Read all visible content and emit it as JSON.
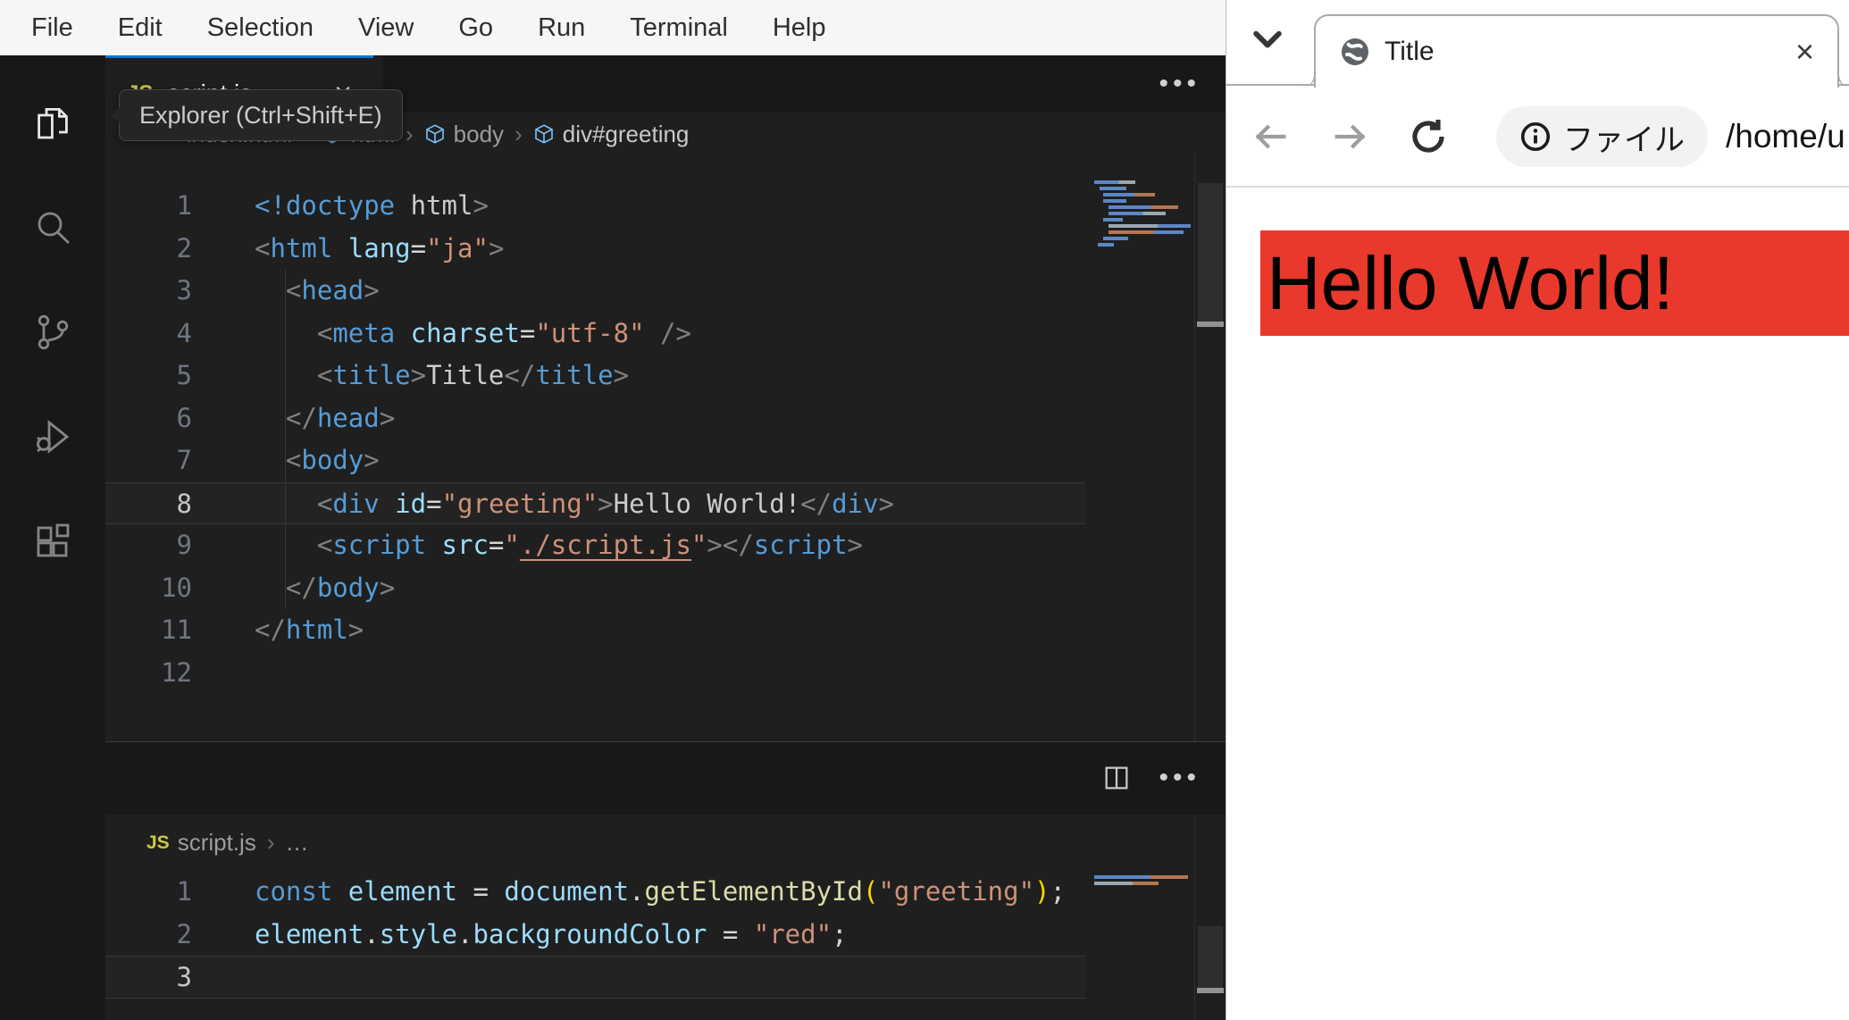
{
  "colors": {
    "accent_blue": "#0078d4",
    "banner_red": "#e9392d",
    "js_yellow": "#cbcb41",
    "html_orange": "#e37933"
  },
  "vscode": {
    "menu": [
      "File",
      "Edit",
      "Selection",
      "View",
      "Go",
      "Run",
      "Terminal",
      "Help"
    ],
    "activity_bar": [
      {
        "icon": "files-icon",
        "active": true
      },
      {
        "icon": "search-icon",
        "active": false
      },
      {
        "icon": "source-control-icon",
        "active": false
      },
      {
        "icon": "run-debug-icon",
        "active": false
      },
      {
        "icon": "extensions-icon",
        "active": false
      }
    ],
    "tooltip": "Explorer (Ctrl+Shift+E)",
    "more_actions": "•••",
    "html_editor": {
      "breadcrumbs": [
        {
          "icon": "code",
          "label": "index.html"
        },
        {
          "icon": "cube",
          "label": "html"
        },
        {
          "icon": "cube",
          "label": "body"
        },
        {
          "icon": "cube",
          "label": "div#greeting"
        }
      ],
      "active_line": 8,
      "guide_lines": [
        3,
        4,
        5,
        6,
        7,
        8,
        9,
        10
      ],
      "lines": [
        [
          {
            "c": "tag",
            "t": "<!doctype"
          },
          {
            "c": "txt",
            "t": " html"
          },
          {
            "c": "pt",
            "t": ">"
          }
        ],
        [
          {
            "c": "pt",
            "t": "<"
          },
          {
            "c": "tag",
            "t": "html"
          },
          {
            "c": "attr",
            "t": " lang"
          },
          {
            "c": "op",
            "t": "="
          },
          {
            "c": "str",
            "t": "\"ja\""
          },
          {
            "c": "pt",
            "t": ">"
          }
        ],
        [
          {
            "c": "txt",
            "t": "  "
          },
          {
            "c": "pt",
            "t": "<"
          },
          {
            "c": "tag",
            "t": "head"
          },
          {
            "c": "pt",
            "t": ">"
          }
        ],
        [
          {
            "c": "txt",
            "t": "    "
          },
          {
            "c": "pt",
            "t": "<"
          },
          {
            "c": "tag",
            "t": "meta"
          },
          {
            "c": "attr",
            "t": " charset"
          },
          {
            "c": "op",
            "t": "="
          },
          {
            "c": "str",
            "t": "\"utf-8\""
          },
          {
            "c": "pt",
            "t": " />"
          }
        ],
        [
          {
            "c": "txt",
            "t": "    "
          },
          {
            "c": "pt",
            "t": "<"
          },
          {
            "c": "tag",
            "t": "title"
          },
          {
            "c": "pt",
            "t": ">"
          },
          {
            "c": "txt",
            "t": "Title"
          },
          {
            "c": "pt",
            "t": "</"
          },
          {
            "c": "tag",
            "t": "title"
          },
          {
            "c": "pt",
            "t": ">"
          }
        ],
        [
          {
            "c": "txt",
            "t": "  "
          },
          {
            "c": "pt",
            "t": "</"
          },
          {
            "c": "tag",
            "t": "head"
          },
          {
            "c": "pt",
            "t": ">"
          }
        ],
        [
          {
            "c": "txt",
            "t": "  "
          },
          {
            "c": "pt",
            "t": "<"
          },
          {
            "c": "tag",
            "t": "body"
          },
          {
            "c": "pt",
            "t": ">"
          }
        ],
        [
          {
            "c": "txt",
            "t": "    "
          },
          {
            "c": "pt",
            "t": "<"
          },
          {
            "c": "tag",
            "t": "div"
          },
          {
            "c": "attr",
            "t": " id"
          },
          {
            "c": "op",
            "t": "="
          },
          {
            "c": "str",
            "t": "\"greeting\""
          },
          {
            "c": "pt",
            "t": ">"
          },
          {
            "c": "txt",
            "t": "Hello World!"
          },
          {
            "c": "pt",
            "t": "</"
          },
          {
            "c": "tag",
            "t": "div"
          },
          {
            "c": "pt",
            "t": ">"
          }
        ],
        [
          {
            "c": "txt",
            "t": "    "
          },
          {
            "c": "pt",
            "t": "<"
          },
          {
            "c": "tag",
            "t": "script"
          },
          {
            "c": "attr",
            "t": " src"
          },
          {
            "c": "op",
            "t": "="
          },
          {
            "c": "str",
            "t": "\""
          },
          {
            "c": "lnk",
            "t": "./script.js"
          },
          {
            "c": "str",
            "t": "\""
          },
          {
            "c": "pt",
            "t": ">"
          },
          {
            "c": "pt",
            "t": "</"
          },
          {
            "c": "tag",
            "t": "script"
          },
          {
            "c": "pt",
            "t": ">"
          }
        ],
        [
          {
            "c": "txt",
            "t": "  "
          },
          {
            "c": "pt",
            "t": "</"
          },
          {
            "c": "tag",
            "t": "body"
          },
          {
            "c": "pt",
            "t": ">"
          }
        ],
        [
          {
            "c": "pt",
            "t": "</"
          },
          {
            "c": "tag",
            "t": "html"
          },
          {
            "c": "pt",
            "t": ">"
          }
        ],
        []
      ]
    },
    "js_editor": {
      "tab": {
        "icon_label": "JS",
        "label": "script.js",
        "close": "×"
      },
      "breadcrumbs": [
        {
          "icon": "js",
          "label": "script.js"
        },
        {
          "icon": null,
          "label": "…"
        }
      ],
      "active_line": 3,
      "guide_lines": [],
      "lines": [
        [
          {
            "c": "kw",
            "t": "const"
          },
          {
            "c": "var",
            "t": " element "
          },
          {
            "c": "op",
            "t": "= "
          },
          {
            "c": "var",
            "t": "document"
          },
          {
            "c": "op",
            "t": "."
          },
          {
            "c": "fn",
            "t": "getElementById"
          },
          {
            "c": "au",
            "t": "("
          },
          {
            "c": "str",
            "t": "\"greeting\""
          },
          {
            "c": "au",
            "t": ")"
          },
          {
            "c": "op",
            "t": ";"
          }
        ],
        [
          {
            "c": "var",
            "t": "element"
          },
          {
            "c": "op",
            "t": "."
          },
          {
            "c": "var",
            "t": "style"
          },
          {
            "c": "op",
            "t": "."
          },
          {
            "c": "var",
            "t": "backgroundColor"
          },
          {
            "c": "op",
            "t": " = "
          },
          {
            "c": "str",
            "t": "\"red\""
          },
          {
            "c": "op",
            "t": ";"
          }
        ],
        []
      ]
    }
  },
  "browser": {
    "tab": {
      "title": "Title",
      "close": "×"
    },
    "toolbar": {
      "chip_label": "ファイル",
      "url": "/home/u"
    },
    "page": {
      "heading": "Hello World!"
    }
  }
}
